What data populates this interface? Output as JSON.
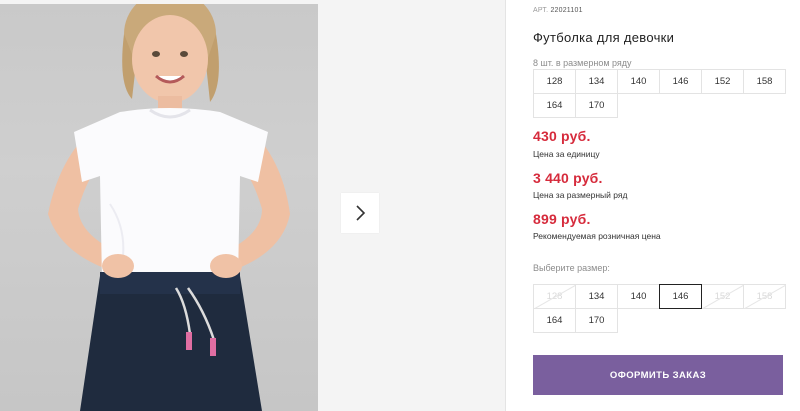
{
  "product": {
    "article_label": "АРТ.",
    "article_number": "22021101",
    "title": "Футболка для девочки",
    "pack_note": "8 шт. в размерном ряду",
    "pack_sizes": [
      "128",
      "134",
      "140",
      "146",
      "152",
      "158",
      "164",
      "170"
    ]
  },
  "prices": [
    {
      "amount": "430 руб.",
      "note": "Цена за единицу"
    },
    {
      "amount": "3 440 руб.",
      "note": "Цена за размерный ряд"
    },
    {
      "amount": "899 руб.",
      "note": "Рекомендуемая розничная цена"
    }
  ],
  "size_select": {
    "label": "Выберите размер:",
    "options": [
      {
        "label": "128",
        "state": "unavailable"
      },
      {
        "label": "134",
        "state": "available"
      },
      {
        "label": "140",
        "state": "available"
      },
      {
        "label": "146",
        "state": "selected"
      },
      {
        "label": "152",
        "state": "unavailable"
      },
      {
        "label": "158",
        "state": "unavailable"
      },
      {
        "label": "164",
        "state": "available"
      },
      {
        "label": "170",
        "state": "available"
      }
    ]
  },
  "order_button": {
    "label": "ОФОРМИТЬ ЗАКАЗ",
    "color": "#7a5f9e"
  },
  "gallery": {
    "next_icon": "chevron-right-icon"
  },
  "colors": {
    "price": "#d62b3c",
    "accent": "#7a5f9e"
  }
}
